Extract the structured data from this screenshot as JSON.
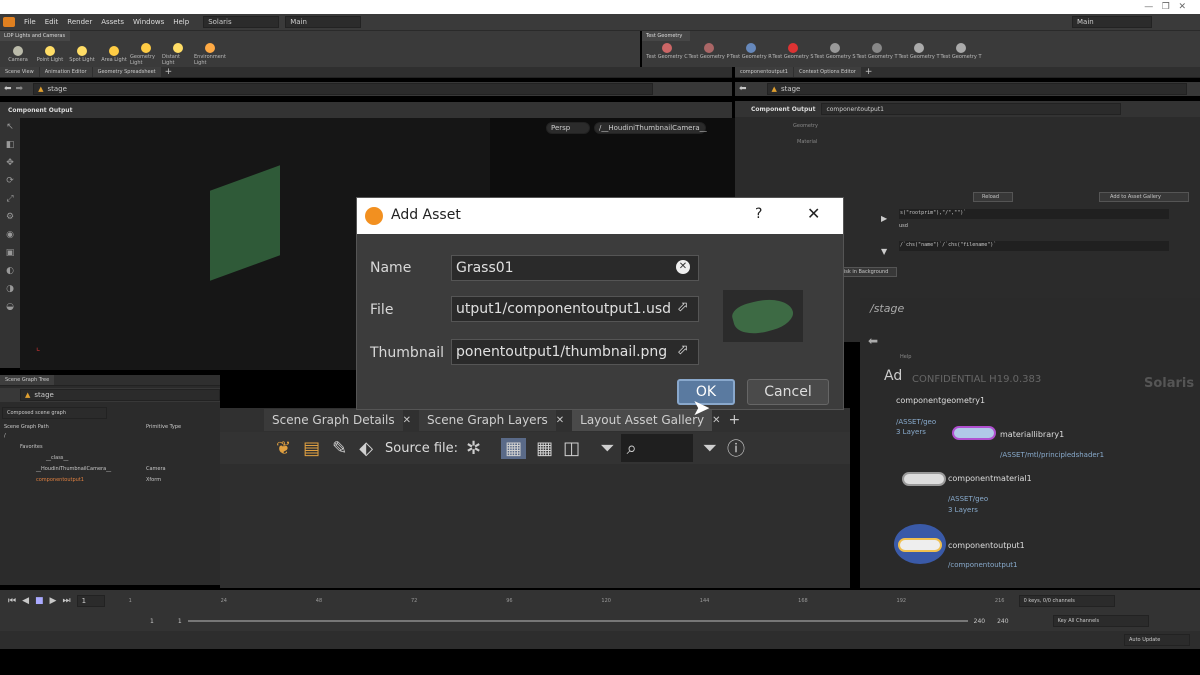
{
  "menu": [
    "File",
    "Edit",
    "Render",
    "Assets",
    "Windows",
    "Help"
  ],
  "desktop": {
    "value": "Solaris",
    "context": "Main",
    "right_context": "Main"
  },
  "shelf_left": {
    "tab": "LOP Lights and Cameras",
    "tools": [
      "Camera",
      "Point Light",
      "Spot Light",
      "Area Light",
      "Geometry Light",
      "Distant Light",
      "Environment Light"
    ]
  },
  "shelf_right": {
    "tab": "Test Geometry",
    "tools": [
      "Test Geometry C",
      "Test Geometry P",
      "Test Geometry R",
      "Test Geometry S",
      "Test Geometry S",
      "Test Geometry T",
      "Test Geometry T",
      "Test Geometry T"
    ]
  },
  "left_tabs": [
    "Scene View",
    "Animation Editor",
    "Geometry Spreadsheet"
  ],
  "right_tabs": [
    "componentoutput1",
    "Context Options Editor"
  ],
  "stage_path": "stage",
  "viewport": {
    "title": "Component Output",
    "persp": "Persp",
    "camera": "/__HoudiniThumbnailCamera__"
  },
  "params": {
    "node_type": "Component Output",
    "node_name": "componentoutput1",
    "labels": [
      "Geometry",
      "Material"
    ],
    "buttons": [
      "Disk in Background",
      "Reload",
      "Add to Asset Gallery"
    ],
    "expr1": "s(\"rootprim\"),\"/\",\"\")`",
    "usd": "usd",
    "expr2": "/`chs(\"name\")`/`chs(\"filename\")`"
  },
  "network": {
    "path": "/stage",
    "watermark": "CONFIDENTIAL H19.0.383",
    "context": "Solaris",
    "help": "Help",
    "nodes": [
      {
        "name": "componentgeometry1",
        "sub": "/ASSET/geo",
        "sub2": "3 Layers"
      },
      {
        "name": "materiallibrary1",
        "sub": "/ASSET/mtl/principledshader1"
      },
      {
        "name": "componentmaterial1",
        "sub": "/ASSET/geo",
        "sub2": "3 Layers"
      },
      {
        "name": "componentoutput1",
        "sub": "/componentoutput1"
      }
    ]
  },
  "scene_graph": {
    "tab": "Scene Graph Tree",
    "path": "stage",
    "mode": "Composed scene graph",
    "col1": "Scene Graph Path",
    "col2": "Primitive Type",
    "rows": [
      {
        "name": "/",
        "type": ""
      },
      {
        "name": "Favorites",
        "type": ""
      },
      {
        "name": "__class__",
        "type": ""
      },
      {
        "name": "__HoudiniThumbnailCamera__",
        "type": "Camera"
      },
      {
        "name": "componentoutput1",
        "type": "Xform"
      }
    ]
  },
  "gallery": {
    "tabs": [
      "Scene Graph Details",
      "Scene Graph Layers",
      "Layout Asset Gallery"
    ],
    "source_label": "Source file:"
  },
  "dialog": {
    "title": "Add Asset",
    "help": "?",
    "name_label": "Name",
    "name_value": "Grass01",
    "file_label": "File",
    "file_value": "utput1/componentoutput1.usd",
    "thumb_label": "Thumbnail",
    "thumb_value": "ponentoutput1/thumbnail.png",
    "ok": "OK",
    "cancel": "Cancel"
  },
  "timeline": {
    "frame": "1",
    "start": "1",
    "start2": "1",
    "end": "240",
    "end2": "240",
    "ticks": [
      "1",
      "24",
      "48",
      "72",
      "96",
      "120",
      "144",
      "168",
      "192",
      "216"
    ],
    "keys": "0 keys, 0/0 channels",
    "key_all": "Key All Channels",
    "auto": "Auto Update"
  },
  "colors": {
    "accent": "#f0a020",
    "ok_bg": "#5a7aa0",
    "node_purple": "#b050d0",
    "node_blue": "#4a70c0"
  }
}
